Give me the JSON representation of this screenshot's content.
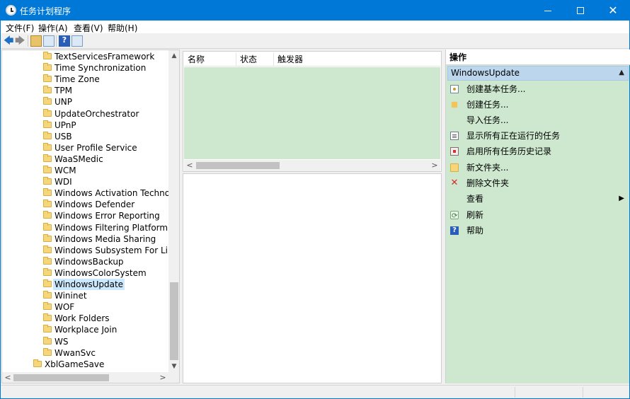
{
  "window": {
    "title": "任务计划程序",
    "controls": {
      "minimize": "—",
      "maximize": "☐",
      "close": "✕"
    }
  },
  "menu": [
    {
      "label": "文件(F)"
    },
    {
      "label": "操作(A)"
    },
    {
      "label": "查看(V)"
    },
    {
      "label": "帮助(H)"
    }
  ],
  "toolbar": {
    "back_icon": "back-arrow-icon",
    "forward_icon": "forward-arrow-icon",
    "help_glyph": "?"
  },
  "tree": {
    "items": [
      {
        "label": "TextServicesFramework"
      },
      {
        "label": "Time Synchronization"
      },
      {
        "label": "Time Zone"
      },
      {
        "label": "TPM"
      },
      {
        "label": "UNP"
      },
      {
        "label": "UpdateOrchestrator"
      },
      {
        "label": "UPnP"
      },
      {
        "label": "USB"
      },
      {
        "label": "User Profile Service"
      },
      {
        "label": "WaaSMedic"
      },
      {
        "label": "WCM"
      },
      {
        "label": "WDI"
      },
      {
        "label": "Windows Activation Technolo"
      },
      {
        "label": "Windows Defender"
      },
      {
        "label": "Windows Error Reporting"
      },
      {
        "label": "Windows Filtering Platform"
      },
      {
        "label": "Windows Media Sharing"
      },
      {
        "label": "Windows Subsystem For Linux"
      },
      {
        "label": "WindowsBackup"
      },
      {
        "label": "WindowsColorSystem"
      },
      {
        "label": "WindowsUpdate",
        "selected": true
      },
      {
        "label": "Wininet"
      },
      {
        "label": "WOF"
      },
      {
        "label": "Work Folders"
      },
      {
        "label": "Workplace Join"
      },
      {
        "label": "WS"
      },
      {
        "label": "WwanSvc"
      },
      {
        "label": "XblGameSave",
        "level": 0
      }
    ],
    "scroll": {
      "up": "▲",
      "down": "▼",
      "left": "<",
      "right": ">"
    }
  },
  "list": {
    "columns": [
      {
        "label": "名称"
      },
      {
        "label": "状态"
      },
      {
        "label": "触发器"
      }
    ],
    "scroll": {
      "left": "<",
      "right": ">"
    }
  },
  "actions": {
    "title": "操作",
    "section": "WindowsUpdate",
    "collapse_glyph": "▲",
    "items": [
      {
        "label": "创建基本任务...",
        "icon": "create-basic-task-icon"
      },
      {
        "label": "创建任务...",
        "icon": "create-task-icon"
      },
      {
        "label": "导入任务...",
        "icon": "none"
      },
      {
        "label": "显示所有正在运行的任务",
        "icon": "running-tasks-icon"
      },
      {
        "label": "启用所有任务历史记录",
        "icon": "task-history-icon"
      },
      {
        "label": "新文件夹...",
        "icon": "new-folder-icon"
      },
      {
        "label": "删除文件夹",
        "icon": "delete-icon"
      },
      {
        "label": "查看",
        "icon": "none",
        "submenu": "▶"
      },
      {
        "label": "刷新",
        "icon": "refresh-icon"
      },
      {
        "label": "帮助",
        "icon": "help-icon"
      }
    ],
    "delete_glyph": "✕",
    "help_glyph": "?"
  }
}
